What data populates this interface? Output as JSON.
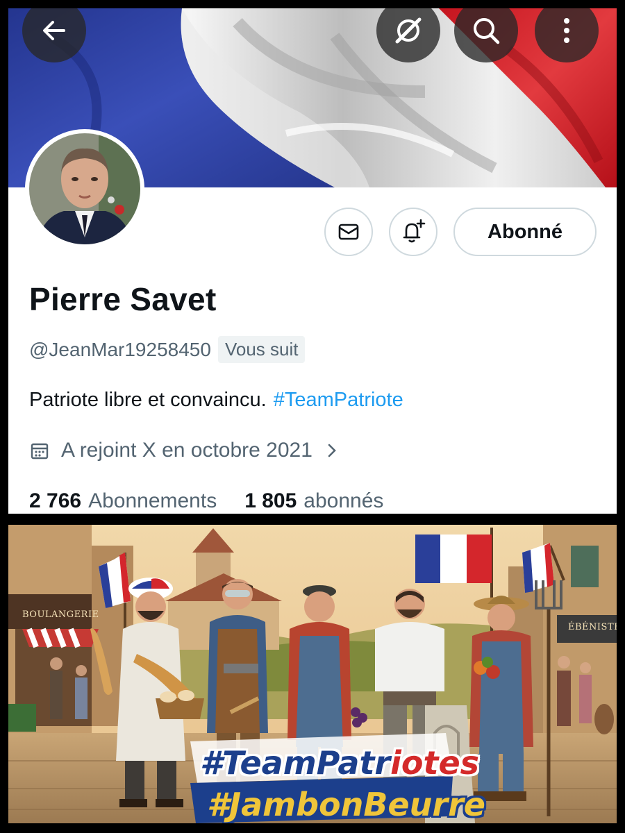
{
  "header": {
    "icons": [
      "back-arrow-icon",
      "grok-icon",
      "search-icon",
      "more-vertical-icon"
    ]
  },
  "banner": {
    "subject": "french-flag",
    "colors": [
      "#2f3f9e",
      "#eeeeee",
      "#d6202c"
    ]
  },
  "actions": {
    "message_icon": "mail-icon",
    "notify_icon": "bell-plus-icon",
    "follow_label": "Abonné"
  },
  "profile": {
    "name": "Pierre Savet",
    "handle": "@JeanMar19258450",
    "follows_you": "Vous suit",
    "bio": "Patriote libre et convaincu.",
    "bio_hashtag": "#TeamPatriote",
    "joined": "A rejoint X en octobre 2021"
  },
  "stats": {
    "following_count": "2 766",
    "following_label": "Abonnements",
    "followers_count": "1 805",
    "followers_label": "abonnés"
  },
  "poster": {
    "sign_left": "BOULANGERIE",
    "sign_right": "ÉBÉNISTE",
    "tag1_a": "#TeamPatr",
    "tag1_b": "iotes",
    "tag2": "#JambonBeurre"
  },
  "colors": {
    "accent": "#1d9bf0",
    "text_primary": "#0f1419",
    "text_secondary": "#536471",
    "border": "#cfd9de"
  }
}
